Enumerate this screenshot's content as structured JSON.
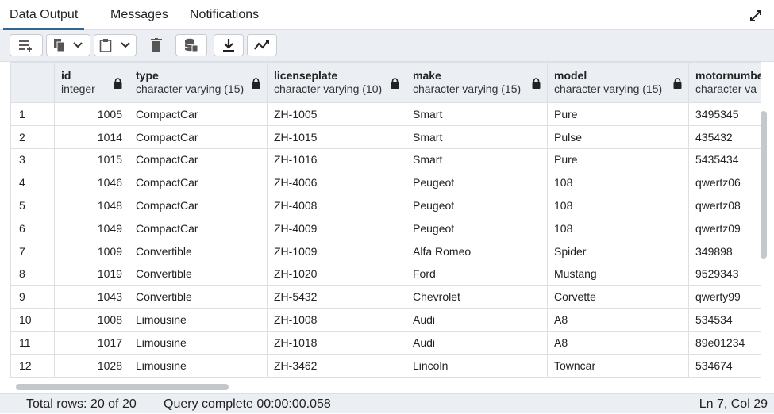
{
  "tabs": [
    {
      "label": "Data Output",
      "active": true
    },
    {
      "label": "Messages",
      "active": false
    },
    {
      "label": "Notifications",
      "active": false
    }
  ],
  "toolbar": {
    "icons": [
      "add-row-icon",
      "copy-icon",
      "chevron-down-icon",
      "paste-icon",
      "chevron-down-icon",
      "delete-icon",
      "save-data-icon",
      "download-icon",
      "graph-icon"
    ]
  },
  "columns": [
    {
      "name": "",
      "type": ""
    },
    {
      "name": "id",
      "type": "integer"
    },
    {
      "name": "type",
      "type": "character varying (15)"
    },
    {
      "name": "licenseplate",
      "type": "character varying (10)"
    },
    {
      "name": "make",
      "type": "character varying (15)"
    },
    {
      "name": "model",
      "type": "character varying (15)"
    },
    {
      "name": "motornumbe",
      "type": "character va"
    }
  ],
  "rows": [
    [
      "1",
      "1005",
      "CompactCar",
      "ZH-1005",
      "Smart",
      "Pure",
      "3495345"
    ],
    [
      "2",
      "1014",
      "CompactCar",
      "ZH-1015",
      "Smart",
      "Pulse",
      "435432"
    ],
    [
      "3",
      "1015",
      "CompactCar",
      "ZH-1016",
      "Smart",
      "Pure",
      "5435434"
    ],
    [
      "4",
      "1046",
      "CompactCar",
      "ZH-4006",
      "Peugeot",
      "108",
      "qwertz06"
    ],
    [
      "5",
      "1048",
      "CompactCar",
      "ZH-4008",
      "Peugeot",
      "108",
      "qwertz08"
    ],
    [
      "6",
      "1049",
      "CompactCar",
      "ZH-4009",
      "Peugeot",
      "108",
      "qwertz09"
    ],
    [
      "7",
      "1009",
      "Convertible",
      "ZH-1009",
      "Alfa Romeo",
      "Spider",
      "349898"
    ],
    [
      "8",
      "1019",
      "Convertible",
      "ZH-1020",
      "Ford",
      "Mustang",
      "9529343"
    ],
    [
      "9",
      "1043",
      "Convertible",
      "ZH-5432",
      "Chevrolet",
      "Corvette",
      "qwerty99"
    ],
    [
      "10",
      "1008",
      "Limousine",
      "ZH-1008",
      "Audi",
      "A8",
      "534534"
    ],
    [
      "11",
      "1017",
      "Limousine",
      "ZH-1018",
      "Audi",
      "A8",
      "89e01234"
    ],
    [
      "12",
      "1028",
      "Limousine",
      "ZH-3462",
      "Lincoln",
      "Towncar",
      "534674"
    ]
  ],
  "status": {
    "total_rows": "Total rows: 20 of 20",
    "query": "Query complete 00:00:00.058",
    "position": "Ln 7, Col 29"
  },
  "colors": {
    "accent": "#326690",
    "toolbar_bg": "#ebeef3",
    "border": "#dcdfe3"
  }
}
